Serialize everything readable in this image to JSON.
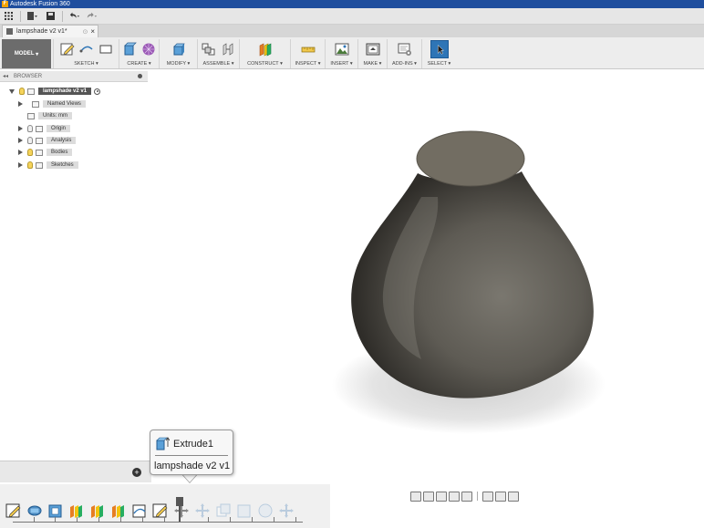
{
  "window": {
    "title": "Autodesk Fusion 360",
    "app_icon": "F"
  },
  "quick_access": {
    "icons": [
      "grid-icon",
      "file-icon",
      "save-icon",
      "undo-icon",
      "redo-icon"
    ]
  },
  "tab": {
    "label": "lampshade v2 v1*"
  },
  "ribbon": {
    "workspace": "MODEL",
    "groups": [
      {
        "label": "SKETCH ▾"
      },
      {
        "label": "CREATE ▾"
      },
      {
        "label": "MODIFY ▾"
      },
      {
        "label": "ASSEMBLE ▾"
      },
      {
        "label": "CONSTRUCT ▾"
      },
      {
        "label": "INSPECT ▾"
      },
      {
        "label": "INSERT ▾"
      },
      {
        "label": "MAKE ▾"
      },
      {
        "label": "ADD-INS ▾"
      },
      {
        "label": "SELECT ▾"
      }
    ]
  },
  "browser": {
    "title": "BROWSER",
    "root": "lampshade v2 v1",
    "items": [
      {
        "label": "Named Views"
      },
      {
        "label": "Units: mm"
      },
      {
        "label": "Origin"
      },
      {
        "label": "Analysis"
      },
      {
        "label": "Bodies"
      },
      {
        "label": "Sketches"
      }
    ]
  },
  "comments": {
    "add": "+"
  },
  "tooltip": {
    "title": "Extrude1",
    "subtitle": "lampshade v2 v1"
  },
  "colors": {
    "title_bar": "#1f4e9e",
    "select_accent": "#2e75b6",
    "model_body": "#5e5b54"
  }
}
